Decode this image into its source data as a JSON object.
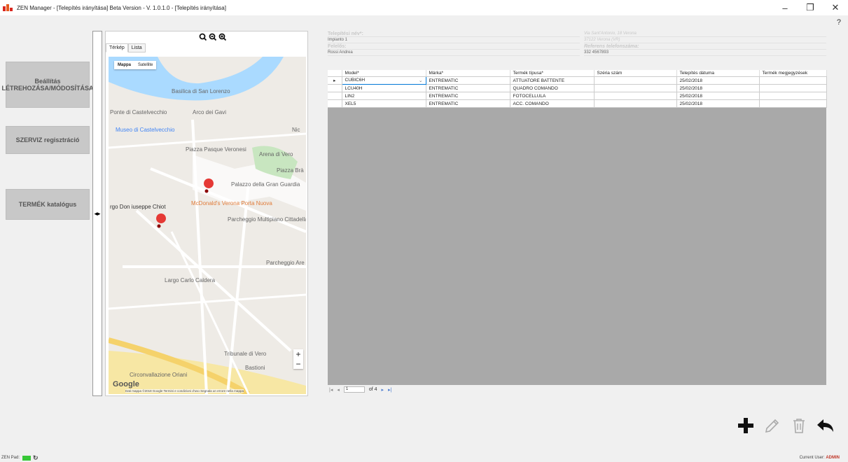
{
  "window": {
    "title": "ZEN Manager - [Telepítés irányítása] Beta Version - V. 1.0.1.0 - [Telepítés irányítása]",
    "minimize": "–",
    "maximize": "❐",
    "close": "✕",
    "help": "?"
  },
  "sidebar": {
    "settings_label": "Beállítás LÉTREHOZÁSA/MÓDOSÍTÁSA",
    "service_label": "SZERVIZ regisztráció",
    "catalog_label": "TERMÉK katalógus"
  },
  "map": {
    "zoom_tools": "⚲⚲⚲",
    "tab_map": "Térkép",
    "tab_list": "Lista",
    "type_map": "Mappa",
    "type_satellite": "Satellite",
    "google": "Google",
    "attribution": "Dati mappa ©2018 Google  Termini e condizioni d'uso  Segnala un errore nella mappa",
    "zoom_in": "+",
    "zoom_out": "−",
    "labels": {
      "basilica": "Basilica di San Lorenzo",
      "ponte": "Ponte di Castelvecchio",
      "arco": "Arco dei Gavi",
      "museo": "Museo di Castelvecchio",
      "piazza_pasque": "Piazza Pasque Veronesi",
      "arena": "Arena di Vero",
      "piazza_bra": "Piazza Brà",
      "palazzo": "Palazzo della Gran Guardia",
      "mcdonalds": "McDonald's Verona Porta Nuova",
      "parcheggio1": "Parcheggio Multipiano Cittadella",
      "parcheggio2": "Parcheggio Are",
      "largo": "Largo Carlo Caldera",
      "tribunale": "Tribunale di Vero",
      "bastioni": "Bastioni",
      "circonvallazione": "Circonvallazione Oriani",
      "don": "rgo Don iuseppe Chiot",
      "nic": "Nic"
    }
  },
  "info": {
    "site_name_label": "Telepítési név*:",
    "site_name_value": "Impianto 1",
    "contact_label": "Felelős:",
    "contact_value": "Rossi Andrea",
    "address_line1": "Via Sant'Antonio, 18 Verona",
    "address_line2": "37122 Verona (VR)",
    "phone_label": "Referens telefonszáma:",
    "phone_value": "332 4567893"
  },
  "grid": {
    "headers": [
      "Model*",
      "Márka*",
      "Termék típusa*",
      "Széria szám",
      "Telepítés dátuma",
      "Termék megjegyzések"
    ],
    "rows": [
      {
        "indicator": "▸",
        "model": "CUBIC6H",
        "brand": "ENTREMATIC",
        "type": "ATTUATORE BATTENTE",
        "serial": "",
        "date": "25/02/2018",
        "notes": ""
      },
      {
        "indicator": "",
        "model": "LCU40H",
        "brand": "ENTREMATIC",
        "type": "QUADRO COMANDO",
        "serial": "",
        "date": "25/02/2018",
        "notes": ""
      },
      {
        "indicator": "",
        "model": "LIN2",
        "brand": "ENTREMATIC",
        "type": "FOTOCELLULA",
        "serial": "",
        "date": "25/02/2018",
        "notes": ""
      },
      {
        "indicator": "",
        "model": "XEL5",
        "brand": "ENTREMATIC",
        "type": "ACC. COMANDO",
        "serial": "",
        "date": "25/02/2018",
        "notes": ""
      }
    ]
  },
  "navigator": {
    "first": "|◂",
    "prev": "◂",
    "position": "1",
    "of": "of 4",
    "next": "▸",
    "last": "▸|"
  },
  "status": {
    "pad_label": "ZEN Pad:",
    "refresh": "↻",
    "user_prefix": "Current User:",
    "user_name": "ADMIN"
  }
}
